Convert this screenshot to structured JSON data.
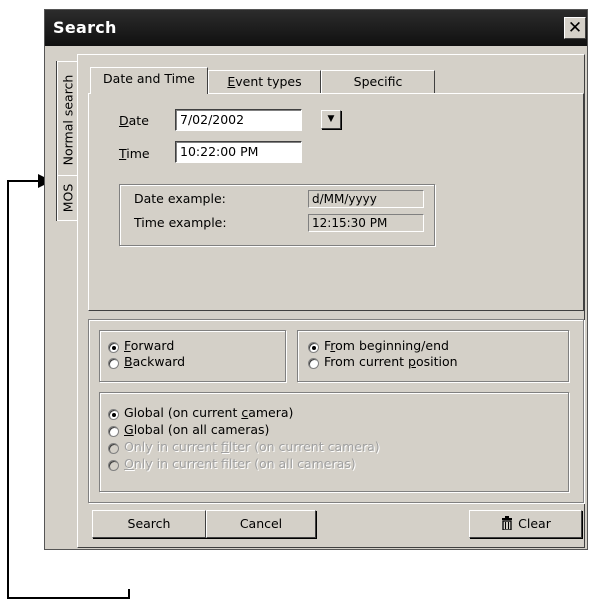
{
  "window": {
    "title": "Search",
    "close_glyph": "✕"
  },
  "side_tabs": [
    {
      "label": "Normal search"
    },
    {
      "label": "MOS"
    }
  ],
  "tabs": [
    {
      "label_pre": "Date and Time",
      "label_u": "",
      "label_post": ""
    },
    {
      "label_pre": "",
      "label_u": "E",
      "label_post": "vent types"
    },
    {
      "label_pre": "Specific",
      "label_u": "",
      "label_post": ""
    }
  ],
  "date": {
    "label_u": "D",
    "label_rest": "ate",
    "value": "7/02/2002",
    "dropdown_glyph": "▼"
  },
  "time": {
    "label_u": "T",
    "label_rest": "ime",
    "value": "10:22:00 PM"
  },
  "examples": {
    "date_label": "Date example:",
    "date_value": "d/MM/yyyy",
    "time_label": "Time example:",
    "time_value": "12:15:30 PM"
  },
  "direction": [
    {
      "u": "F",
      "rest": "orward",
      "pre": "",
      "checked": true
    },
    {
      "u": "B",
      "rest": "ackward",
      "pre": "",
      "checked": false
    }
  ],
  "start": [
    {
      "pre": "F",
      "u": "r",
      "rest": "om beginning/end",
      "checked": true
    },
    {
      "pre": "From current ",
      "u": "p",
      "rest": "osition",
      "checked": false
    }
  ],
  "scope": [
    {
      "pre": "Global (on current ",
      "u": "c",
      "rest": "amera)",
      "checked": true,
      "disabled": false
    },
    {
      "pre": "",
      "u": "G",
      "rest": "lobal (on all cameras)",
      "checked": false,
      "disabled": false
    },
    {
      "pre": "Only in current ",
      "u": "f",
      "rest": "ilter (on current camera)",
      "checked": false,
      "disabled": true
    },
    {
      "pre": "",
      "u": "O",
      "rest": "nly in current filter (on all cameras)",
      "checked": false,
      "disabled": true
    }
  ],
  "buttons": {
    "search": "Search",
    "cancel": "Cancel",
    "clear": "Clear",
    "clear_icon": "trash-icon"
  }
}
